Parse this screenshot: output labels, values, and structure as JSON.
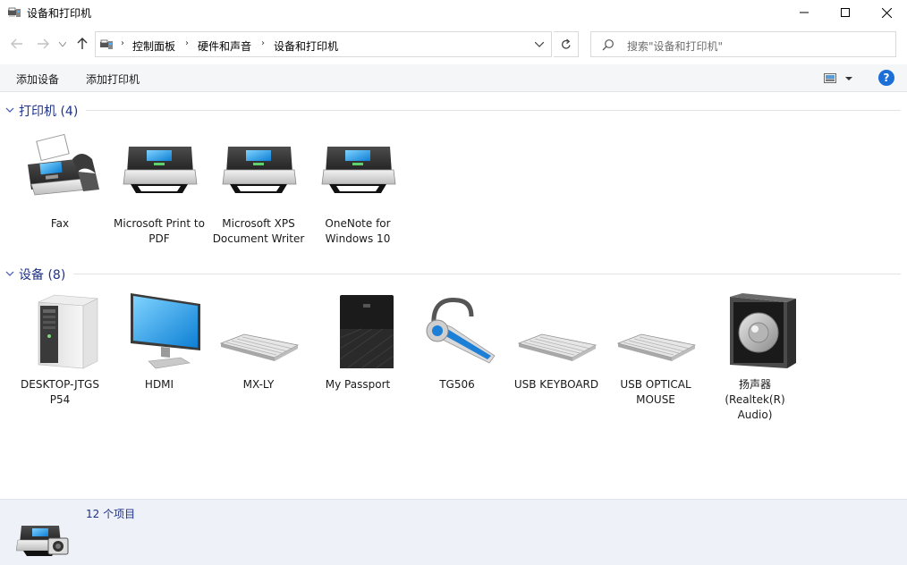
{
  "window": {
    "title": "设备和打印机",
    "minimize_icon": "minimize-icon",
    "maximize_icon": "maximize-icon",
    "close_icon": "close-icon"
  },
  "nav": {
    "back_icon": "arrow-left-icon",
    "forward_icon": "arrow-right-icon",
    "up_icon": "arrow-up-icon",
    "breadcrumb": [
      "控制面板",
      "硬件和声音",
      "设备和打印机"
    ],
    "refresh_icon": "refresh-icon",
    "search_placeholder": "搜索\"设备和打印机\""
  },
  "commands": {
    "add_device": "添加设备",
    "add_printer": "添加打印机",
    "help": "?"
  },
  "groups": {
    "printers": {
      "title": "打印机 (4)",
      "items": [
        {
          "label": "Fax",
          "icon": "fax-icon"
        },
        {
          "label": "Microsoft Print to PDF",
          "icon": "printer-icon"
        },
        {
          "label": "Microsoft XPS Document Writer",
          "icon": "printer-icon"
        },
        {
          "label": "OneNote for Windows 10",
          "icon": "printer-icon"
        }
      ]
    },
    "devices": {
      "title": "设备 (8)",
      "items": [
        {
          "label": "DESKTOP-JTGS P54",
          "icon": "computer-tower-icon"
        },
        {
          "label": "HDMI",
          "icon": "monitor-icon"
        },
        {
          "label": "MX-LY",
          "icon": "keyboard-icon"
        },
        {
          "label": "My Passport",
          "icon": "external-drive-icon"
        },
        {
          "label": "TG506",
          "icon": "headset-icon"
        },
        {
          "label": "USB KEYBOARD",
          "icon": "keyboard-icon"
        },
        {
          "label": "USB OPTICAL MOUSE",
          "icon": "keyboard-icon"
        },
        {
          "label": "扬声器 (Realtek(R) Audio)",
          "icon": "speaker-icon"
        }
      ]
    }
  },
  "details": {
    "count_text": "12 个项目",
    "icon": "devices-printers-icon"
  },
  "colors": {
    "group_title": "#1e3287",
    "cmdbar_bg": "#f5f6f7",
    "details_bg": "#eef1f8",
    "help_blue": "#1c6fd6"
  }
}
